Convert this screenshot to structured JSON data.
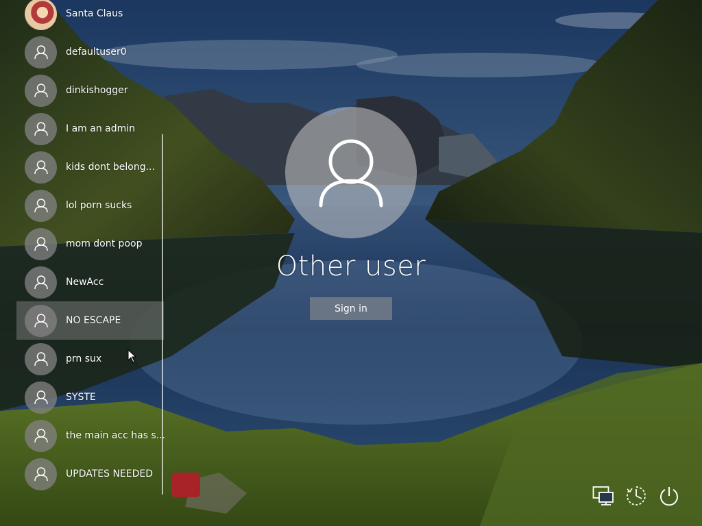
{
  "users": [
    {
      "name": "Santa Claus",
      "avatar": "photo",
      "selected": false
    },
    {
      "name": "defaultuser0",
      "avatar": "default-user-icon",
      "selected": false
    },
    {
      "name": "dinkishogger",
      "avatar": "default-user-icon",
      "selected": false
    },
    {
      "name": "I am an admin",
      "avatar": "default-user-icon",
      "selected": false
    },
    {
      "name": "kids dont belong...",
      "avatar": "default-user-icon",
      "selected": false
    },
    {
      "name": "lol porn sucks",
      "avatar": "default-user-icon",
      "selected": false
    },
    {
      "name": "mom dont poop",
      "avatar": "default-user-icon",
      "selected": false
    },
    {
      "name": "NewAcc",
      "avatar": "default-user-icon",
      "selected": false
    },
    {
      "name": "NO ESCAPE",
      "avatar": "default-user-icon",
      "selected": true
    },
    {
      "name": "prn sux",
      "avatar": "default-user-icon",
      "selected": false
    },
    {
      "name": "SYSTE",
      "avatar": "default-user-icon",
      "selected": false
    },
    {
      "name": "the main acc has s...",
      "avatar": "default-user-icon",
      "selected": false
    },
    {
      "name": "UPDATES NEEDED",
      "avatar": "default-user-icon",
      "selected": false
    }
  ],
  "signin": {
    "user_name": "Other user",
    "button_label": "Sign in"
  },
  "corner_icons": {
    "network": "network-icon",
    "ease_of_access": "ease-of-access-icon",
    "power": "power-icon"
  },
  "colors": {
    "selection": "#8c8c8c",
    "avatar_bg": "#808080"
  }
}
